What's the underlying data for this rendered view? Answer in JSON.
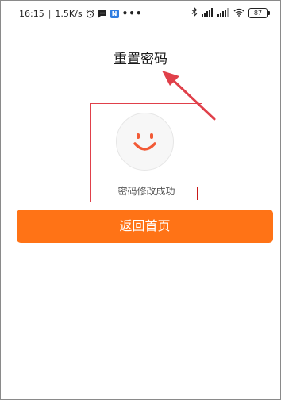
{
  "status_bar": {
    "time": "16:15",
    "network_speed": "1.5K/s",
    "battery_level": "87",
    "icons": [
      "alarm-icon",
      "message-icon",
      "n-app-icon",
      "more-dots-icon",
      "bluetooth-icon",
      "signal-icon",
      "wifi-icon",
      "battery-icon"
    ]
  },
  "page": {
    "title": "重置密码"
  },
  "result": {
    "icon": "smile-icon",
    "message": "密码修改成功"
  },
  "actions": {
    "back_home_label": "返回首页"
  },
  "colors": {
    "accent": "#ff7316",
    "smile": "#f25a36",
    "annotation": "#e0404a"
  }
}
